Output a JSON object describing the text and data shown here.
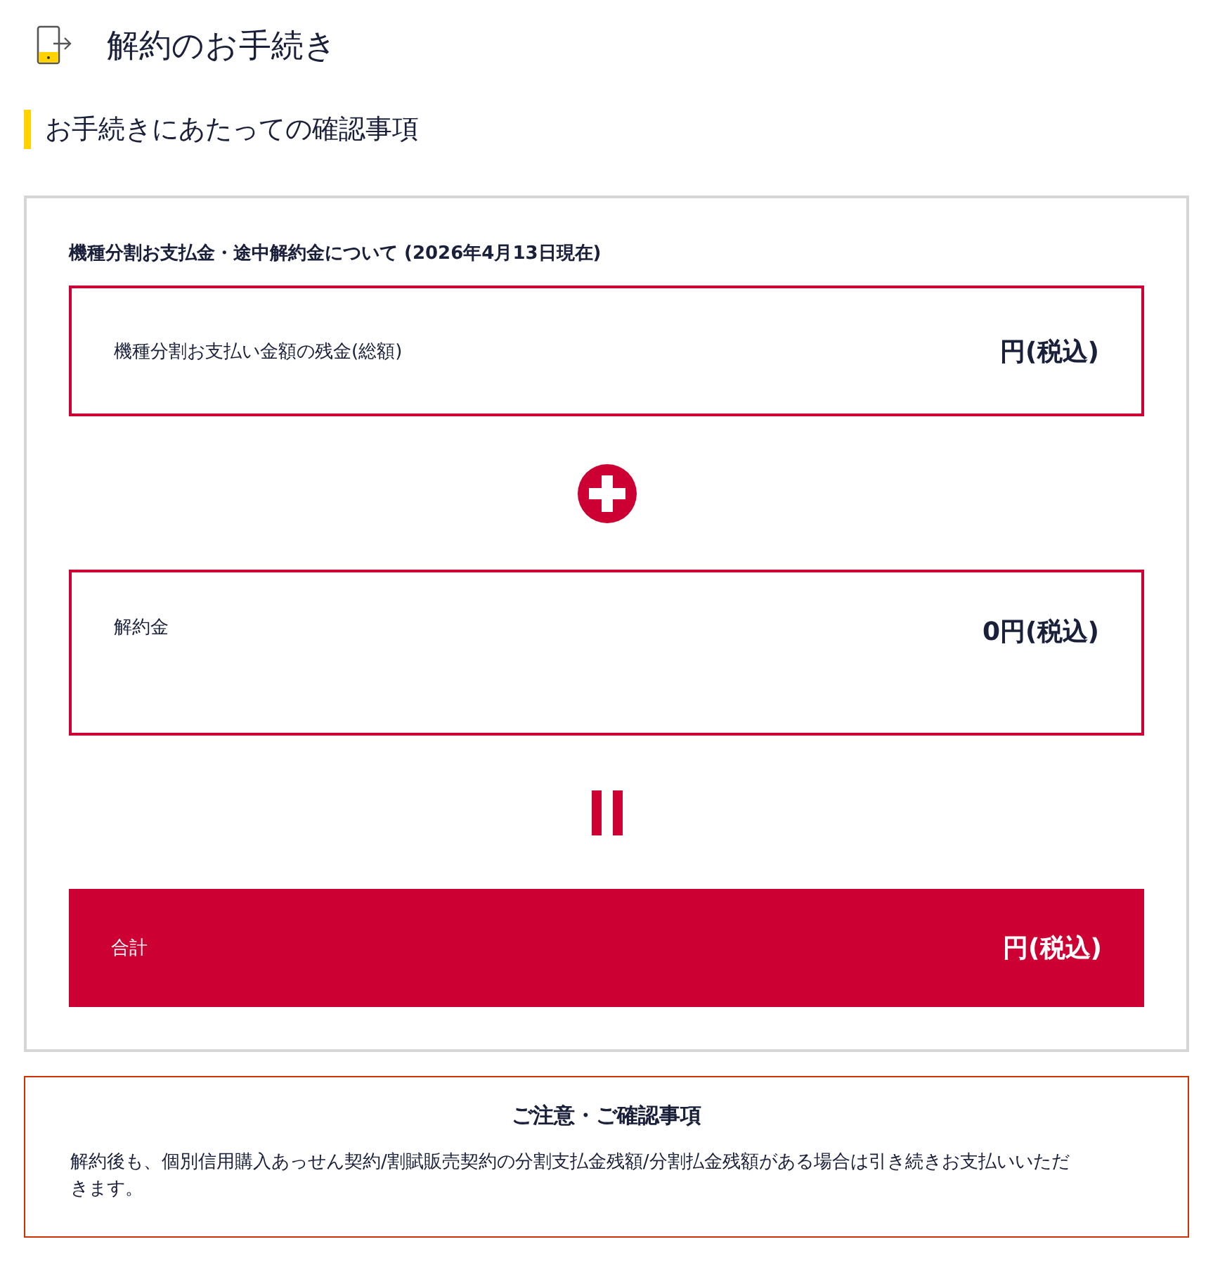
{
  "page_title": "解約のお手続き",
  "section_heading": "お手続きにあたっての確認事項",
  "card": {
    "heading": "機種分割お支払金・途中解約金について (2026年4月13日現在)",
    "items": [
      {
        "kind": "amount",
        "label": "機種分割お支払い金額の残金(総額)",
        "value": "円(税込)",
        "tall": false
      },
      {
        "kind": "amount",
        "label": "解約金",
        "value": "0円(税込)",
        "tall": true
      },
      {
        "kind": "total",
        "label": "合計",
        "value": "円(税込)"
      }
    ]
  },
  "notice": {
    "title": "ご注意・ご確認事項",
    "body": "解約後も、個別信用購入あっせん契約/割賦販売契約の分割支払金残額/分割払金残額がある場合は引き続きお支払いいただきます。"
  }
}
